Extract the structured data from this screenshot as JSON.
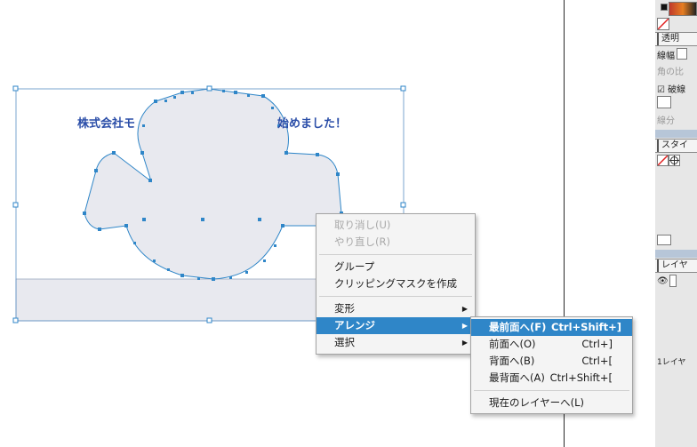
{
  "canvas": {
    "text_left": "株式会社モ",
    "text_right": "始めました！",
    "colors": {
      "shape_fill": "#e8e9ef",
      "selection": "#2f86c8",
      "text": "#2b4ea8"
    }
  },
  "context_menu": {
    "items": [
      {
        "label": "取り消し(U)",
        "disabled": true
      },
      {
        "label": "やり直し(R)",
        "disabled": true
      },
      {
        "label": "グループ"
      },
      {
        "label": "クリッピングマスクを作成"
      },
      {
        "label": "変形",
        "has_submenu": true
      },
      {
        "label": "アレンジ",
        "has_submenu": true,
        "highlighted": true
      },
      {
        "label": "選択",
        "has_submenu": true
      }
    ]
  },
  "arrange_submenu": {
    "items": [
      {
        "label": "最前面へ(F)",
        "shortcut": "Ctrl+Shift+]",
        "highlighted": true
      },
      {
        "label": "前面へ(O)",
        "shortcut": "Ctrl+]"
      },
      {
        "label": "背面へ(B)",
        "shortcut": "Ctrl+["
      },
      {
        "label": "最背面へ(A)",
        "shortcut": "Ctrl+Shift+["
      },
      {
        "label": "現在のレイヤーへ(L)"
      }
    ]
  },
  "right_panel": {
    "tab_transparency": "透明",
    "stroke_width_label": "線幅",
    "corner_label": "角の比",
    "dashed_label": "破線",
    "segment_label": "線分",
    "tab_style": "スタイ",
    "tab_layers": "レイヤ",
    "layers_count": "1レイヤ"
  }
}
